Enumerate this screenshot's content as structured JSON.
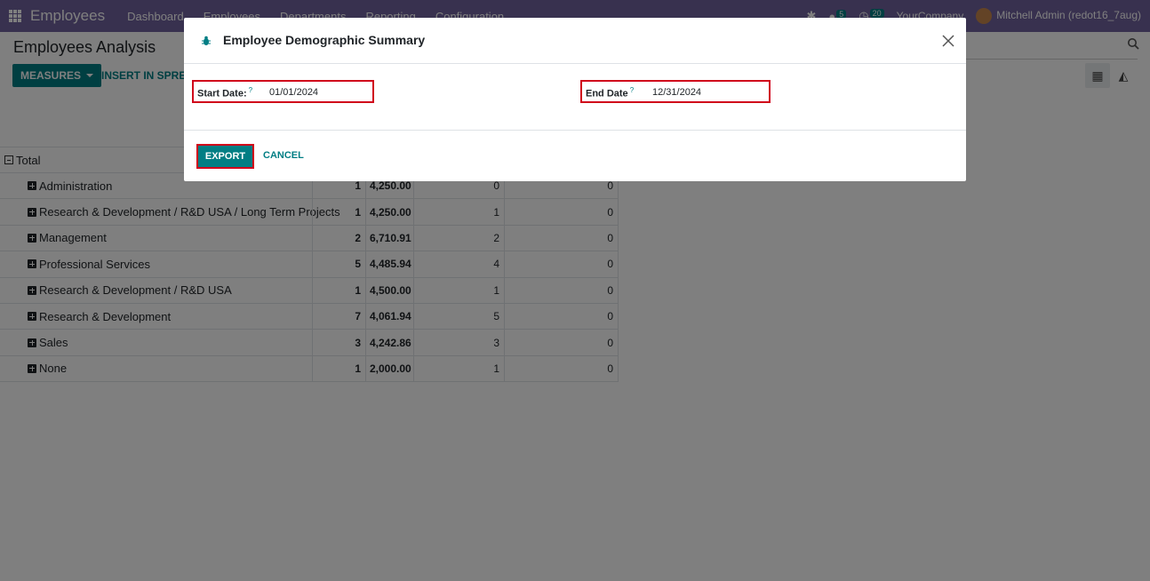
{
  "navbar": {
    "brand": "Employees",
    "menu": [
      "Dashboard",
      "Employees",
      "Departments",
      "Reporting",
      "Configuration"
    ],
    "messages_count": "5",
    "activities_count": "20",
    "company": "YourCompany",
    "user": "Mitchell Admin (redot16_7aug)"
  },
  "control_panel": {
    "title": "Employees Analysis",
    "measures_label": "MEASURES",
    "insert_label": "INSERT IN SPREA"
  },
  "pivot": {
    "total_label": "Total",
    "rows": [
      {
        "label": "Administration",
        "c1": "1",
        "c2": "4,250.00",
        "c3": "0",
        "c4": "0"
      },
      {
        "label": "Research & Development / R&D USA / Long Term Projects",
        "c1": "1",
        "c2": "4,250.00",
        "c3": "1",
        "c4": "0"
      },
      {
        "label": "Management",
        "c1": "2",
        "c2": "6,710.91",
        "c3": "2",
        "c4": "0"
      },
      {
        "label": "Professional Services",
        "c1": "5",
        "c2": "4,485.94",
        "c3": "4",
        "c4": "0"
      },
      {
        "label": "Research & Development / R&D USA",
        "c1": "1",
        "c2": "4,500.00",
        "c3": "1",
        "c4": "0"
      },
      {
        "label": "Research & Development",
        "c1": "7",
        "c2": "4,061.94",
        "c3": "5",
        "c4": "0"
      },
      {
        "label": "Sales",
        "c1": "3",
        "c2": "4,242.86",
        "c3": "3",
        "c4": "0"
      },
      {
        "label": "None",
        "c1": "1",
        "c2": "2,000.00",
        "c3": "1",
        "c4": "0"
      }
    ]
  },
  "modal": {
    "title": "Employee Demographic Summary",
    "start_label": "Start Date:",
    "start_value": "01/01/2024",
    "end_label": "End Date",
    "end_value": "12/31/2024",
    "help_mark": "?",
    "export_label": "EXPORT",
    "cancel_label": "CANCEL"
  },
  "colors": {
    "navbar": "#71639e",
    "primary": "#017e84",
    "highlight_border": "#d0021b"
  }
}
